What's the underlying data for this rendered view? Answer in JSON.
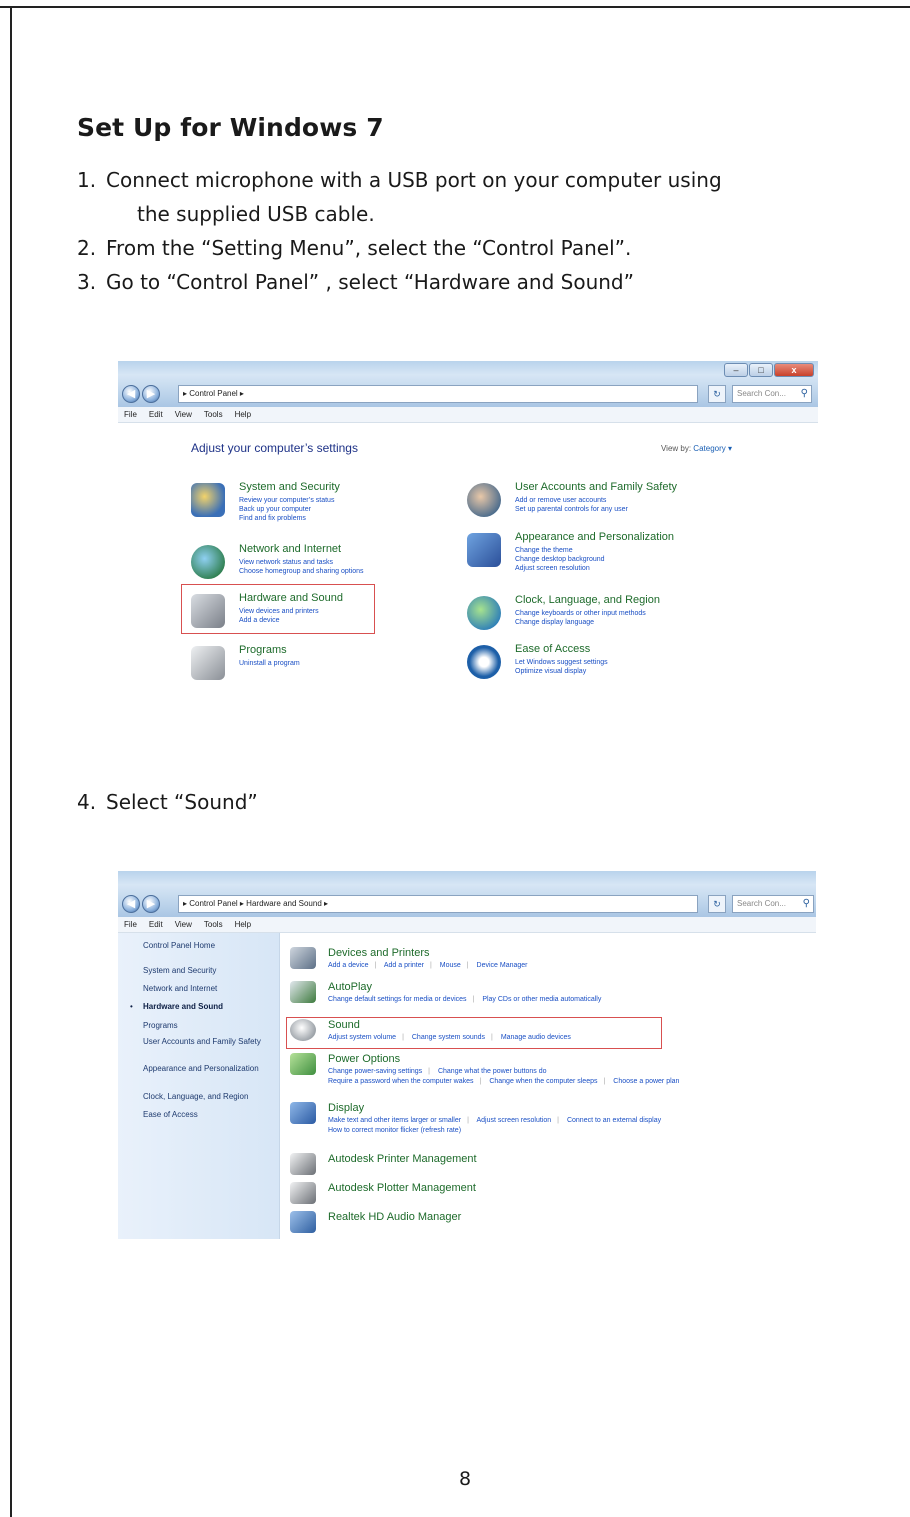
{
  "document": {
    "title": "Set Up for Windows 7",
    "steps": [
      {
        "num": "1.",
        "text": "Connect microphone with a USB port on your computer using",
        "cont": "the supplied USB cable."
      },
      {
        "num": "2.",
        "text": "From the “Setting Menu”, select the “Control Panel”."
      },
      {
        "num": "3.",
        "text": "Go to “Control Panel” , select “Hardware and Sound”"
      }
    ],
    "step4": {
      "num": "4.",
      "text": "Select “Sound”"
    },
    "page_number": "8"
  },
  "screenshot1": {
    "window_buttons": {
      "minimize": "–",
      "maximize": "□",
      "close": "x"
    },
    "address": "▸ Control Panel ▸",
    "search_placeholder": "Search Con...",
    "menu": [
      "File",
      "Edit",
      "View",
      "Tools",
      "Help"
    ],
    "heading": "Adjust your computer’s settings",
    "view_by_label": "View by:",
    "view_by_value": "Category ▾",
    "categories": [
      {
        "title": "System and Security",
        "links": [
          "Review your computer’s status",
          "Back up your computer",
          "Find and fix problems"
        ],
        "icon_color": "#3a6fb7"
      },
      {
        "title": "Network and Internet",
        "links": [
          "View network status and tasks",
          "Choose homegroup and sharing options"
        ],
        "icon_color": "#2f7f4f"
      },
      {
        "title": "Hardware and Sound",
        "links": [
          "View devices and printers",
          "Add a device"
        ],
        "icon_color": "#7a7f88"
      },
      {
        "title": "Programs",
        "links": [
          "Uninstall a program"
        ],
        "icon_color": "#8a8f96"
      },
      {
        "title": "User Accounts and Family Safety",
        "links": [
          "Add or remove user accounts",
          "Set up parental controls for any user"
        ],
        "icon_color": "#4a6b8c"
      },
      {
        "title": "Appearance and Personalization",
        "links": [
          "Change the theme",
          "Change desktop background",
          "Adjust screen resolution"
        ],
        "icon_color": "#2b4f99"
      },
      {
        "title": "Clock, Language, and Region",
        "links": [
          "Change keyboards or other input methods",
          "Change display language"
        ],
        "icon_color": "#2e7fb8"
      },
      {
        "title": "Ease of Access",
        "links": [
          "Let Windows suggest settings",
          "Optimize visual display"
        ],
        "icon_color": "#1d5fa8"
      }
    ]
  },
  "screenshot2": {
    "address": "▸ Control Panel ▸ Hardware and Sound ▸",
    "search_placeholder": "Search Con...",
    "menu": [
      "File",
      "Edit",
      "View",
      "Tools",
      "Help"
    ],
    "sidebar": [
      "Control Panel Home",
      "System and Security",
      "Network and Internet",
      "Hardware and Sound",
      "Programs",
      "User Accounts and Family Safety",
      "Appearance and Personalization",
      "Clock, Language, and Region",
      "Ease of Access"
    ],
    "active_bullet": "•",
    "items": [
      {
        "title": "Devices and Printers",
        "links": [
          [
            "Add a device",
            "Add a printer",
            "Mouse",
            "Device Manager"
          ]
        ],
        "icon_color": "#5c6f86"
      },
      {
        "title": "AutoPlay",
        "links": [
          [
            "Change default settings for media or devices",
            "Play CDs or other media automatically"
          ]
        ],
        "icon_color": "#3d7a3d"
      },
      {
        "title": "Sound",
        "links": [
          [
            "Adjust system volume",
            "Change system sounds",
            "Manage audio devices"
          ]
        ],
        "icon_color": "#9ea4aa"
      },
      {
        "title": "Power Options",
        "links": [
          [
            "Change power-saving settings",
            "Change what the power buttons do"
          ],
          [
            "Require a password when the computer wakes",
            "Change when the computer sleeps",
            "Choose a power plan"
          ]
        ],
        "icon_color": "#3f8f3f"
      },
      {
        "title": "Display",
        "links": [
          [
            "Make text and other items larger or smaller",
            "Adjust screen resolution",
            "Connect to an external display"
          ],
          [
            "How to correct monitor flicker (refresh rate)"
          ]
        ],
        "icon_color": "#2b5aa3"
      },
      {
        "title": "Autodesk Printer Management",
        "links": [],
        "icon_color": "#6b6f75"
      },
      {
        "title": "Autodesk Plotter Management",
        "links": [],
        "icon_color": "#6b6f75"
      },
      {
        "title": "Realtek HD Audio Manager",
        "links": [],
        "icon_color": "#2f5fa0"
      }
    ]
  }
}
